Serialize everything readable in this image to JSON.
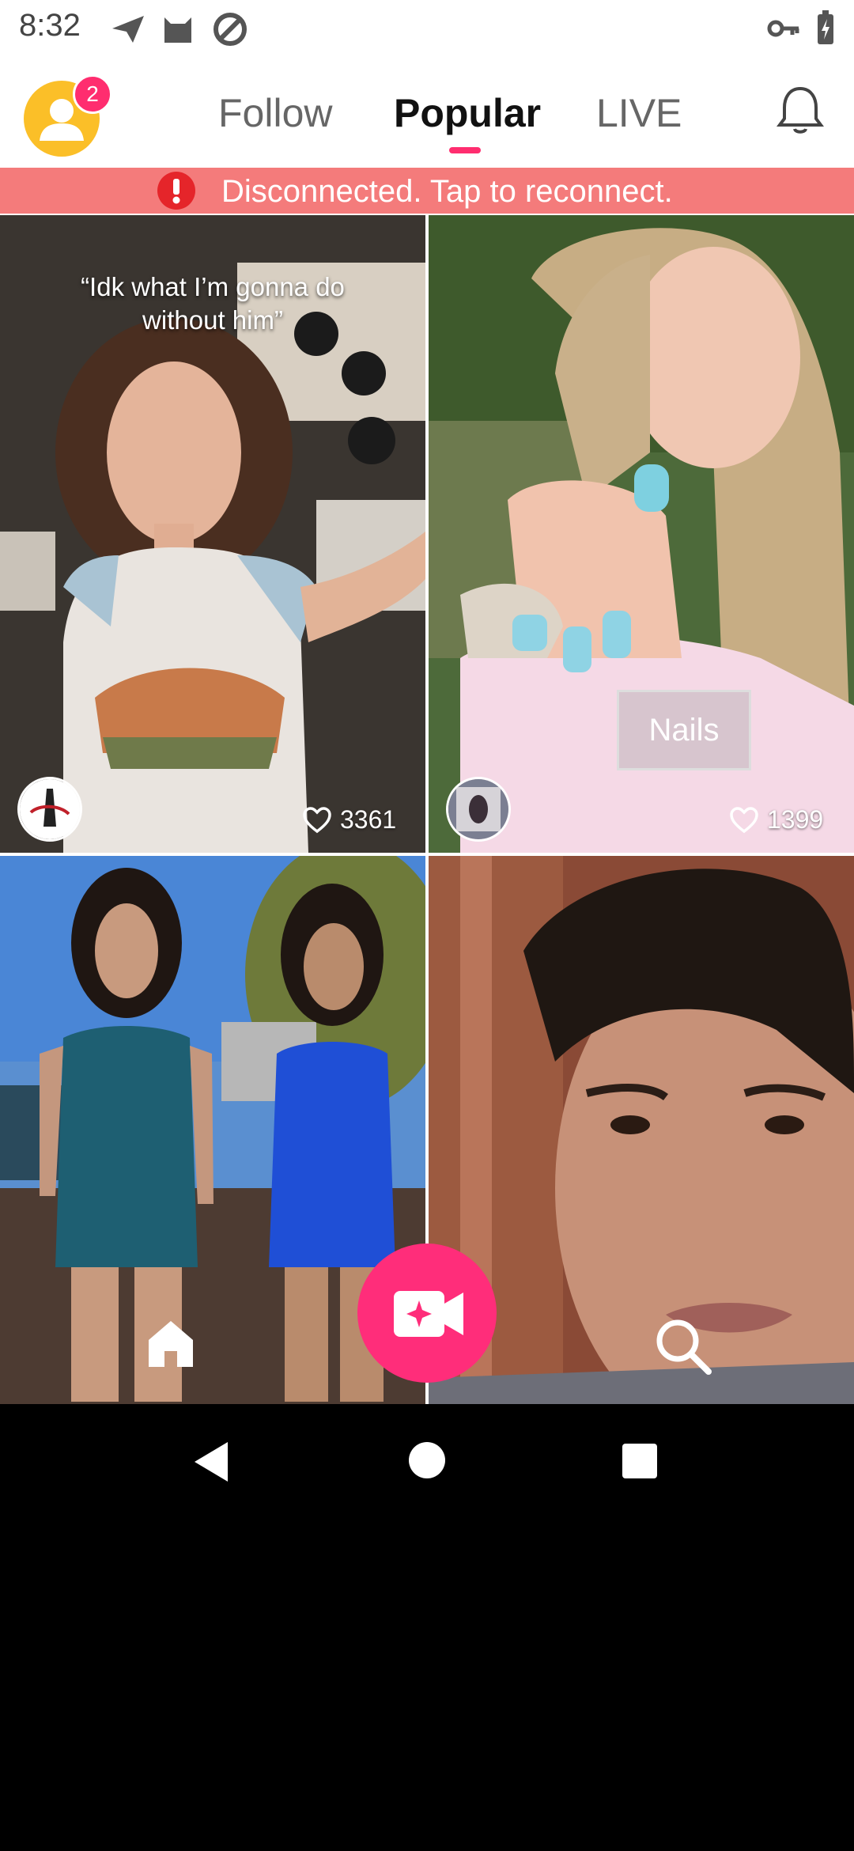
{
  "status_bar": {
    "time": "8:32",
    "icons": [
      "send-icon",
      "cat-icon",
      "do-not-disturb-icon",
      "key-icon",
      "battery-charging-icon"
    ]
  },
  "top_nav": {
    "profile_badge_count": "2",
    "tabs": [
      {
        "label": "Follow",
        "active": false
      },
      {
        "label": "Popular",
        "active": true
      },
      {
        "label": "LIVE",
        "active": false
      }
    ],
    "notification_icon": "bell-icon"
  },
  "banner": {
    "message": "Disconnected. Tap to reconnect.",
    "color": "#f47b7b",
    "icon": "alert-icon"
  },
  "feed": [
    {
      "caption_line1": "“Idk what I’m gonna do",
      "caption_line2": "without him”",
      "likes": "3361"
    },
    {
      "tag": "Nails",
      "likes": "1399"
    },
    {},
    {}
  ],
  "bottom_nav": {
    "home_icon": "home-icon",
    "record_icon": "video-camera-icon",
    "search_icon": "search-icon"
  },
  "colors": {
    "accent": "#ff2d7a",
    "avatar": "#fbbf28"
  }
}
